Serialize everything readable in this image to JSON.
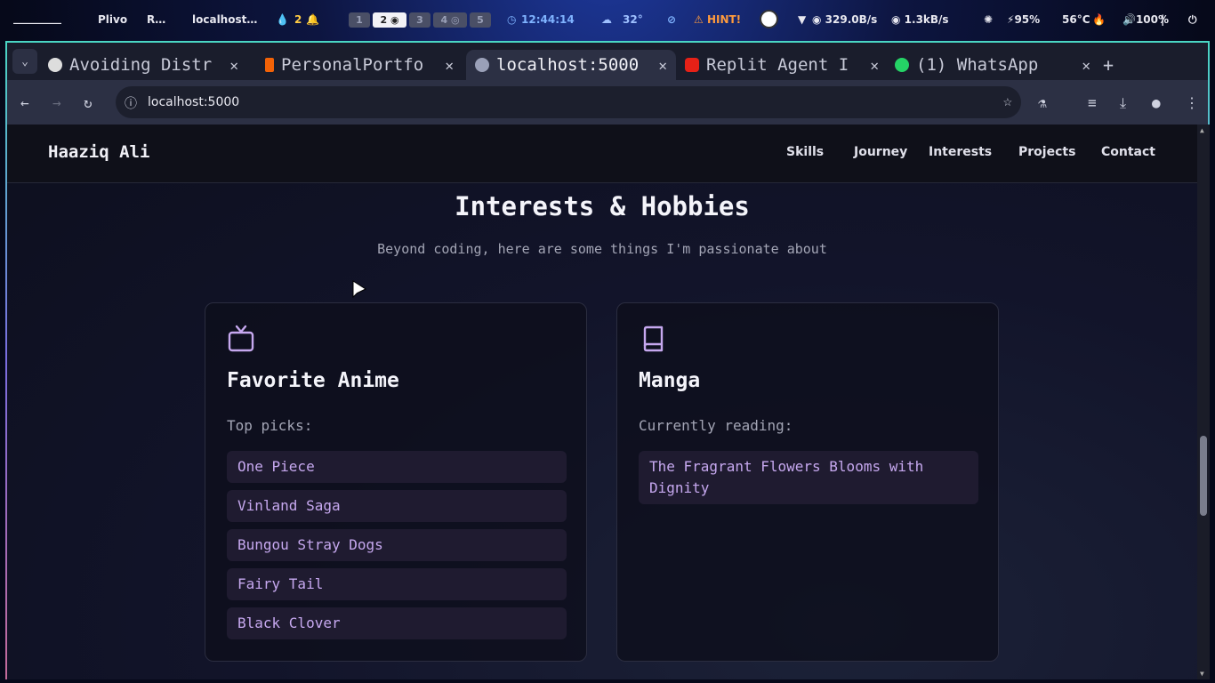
{
  "statusbar": {
    "menu_dashes": "_________",
    "app1": "Plivo",
    "app2": "R…",
    "window_title": "localhost…",
    "notif_count": "2",
    "workspaces": [
      "1",
      "2",
      "3",
      "4",
      "5"
    ],
    "time": "12:44:14",
    "weather": "32°",
    "hint": "HINT!",
    "net_down": "329.0B/s",
    "net_up": "1.3kB/s",
    "battery": "95%",
    "temp": "56°C",
    "volume": "100%"
  },
  "tabs": [
    {
      "label": "Avoiding Distr",
      "icon": "openai-icon"
    },
    {
      "label": "PersonalPortfo",
      "icon": "replit-icon"
    },
    {
      "label": "localhost:5000",
      "icon": "globe-icon"
    },
    {
      "label": "Replit Agent I",
      "icon": "youtube-icon"
    },
    {
      "label": "(1) WhatsApp",
      "icon": "whatsapp-icon"
    }
  ],
  "address": {
    "url": "localhost:5000"
  },
  "site": {
    "brand": "Haaziq Ali",
    "nav": [
      "Skills",
      "Journey",
      "Interests",
      "Projects",
      "Contact"
    ],
    "heading": "Interests & Hobbies",
    "subheading": "Beyond coding, here are some things I'm passionate about",
    "cards": [
      {
        "title": "Favorite Anime",
        "label": "Top picks:",
        "items": [
          "One Piece",
          "Vinland Saga",
          "Bungou Stray Dogs",
          "Fairy Tail",
          "Black Clover"
        ]
      },
      {
        "title": "Manga",
        "label": "Currently reading:",
        "items": [
          "The Fragrant Flowers Blooms with Dignity"
        ]
      }
    ]
  },
  "colors": {
    "accent": "#c6a8ef",
    "pill_bg": "#1f1b30",
    "hint": "#ff9b3d",
    "time": "#7fb3ff"
  }
}
